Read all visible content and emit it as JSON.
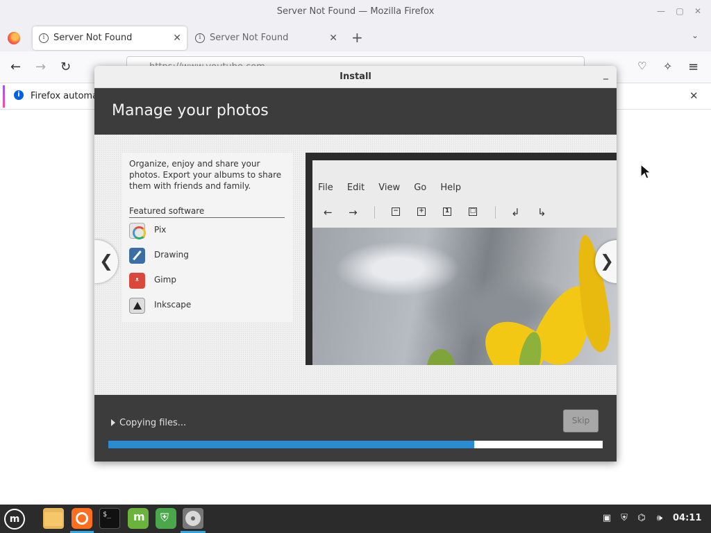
{
  "browser": {
    "window_title": "Server Not Found — Mozilla Firefox",
    "tabs": [
      {
        "label": "Server Not Found",
        "active": true
      },
      {
        "label": "Server Not Found",
        "active": false
      }
    ],
    "url": "https://www.youtube.com",
    "notification": "Firefox automa"
  },
  "dialog": {
    "title": "Install",
    "heading": "Manage your photos",
    "description": "Organize, enjoy and share your photos. Export your albums to share them with friends and family.",
    "featured_heading": "Featured software",
    "apps": [
      {
        "name": "Pix",
        "icon": "pix-icon"
      },
      {
        "name": "Drawing",
        "icon": "drawing-icon"
      },
      {
        "name": "Gimp",
        "icon": "gimp-icon"
      },
      {
        "name": "Inkscape",
        "icon": "inkscape-icon"
      }
    ],
    "screenshot_menu": [
      "File",
      "Edit",
      "View",
      "Go",
      "Help"
    ],
    "status": "Copying files...",
    "skip_label": "Skip",
    "progress": 0.74
  },
  "taskbar": {
    "clock": "04:11"
  },
  "colors": {
    "progress_fill": "#2a8bd2",
    "dialog_dark": "#3c3c3c",
    "taskbar": "#2b2b2b"
  }
}
